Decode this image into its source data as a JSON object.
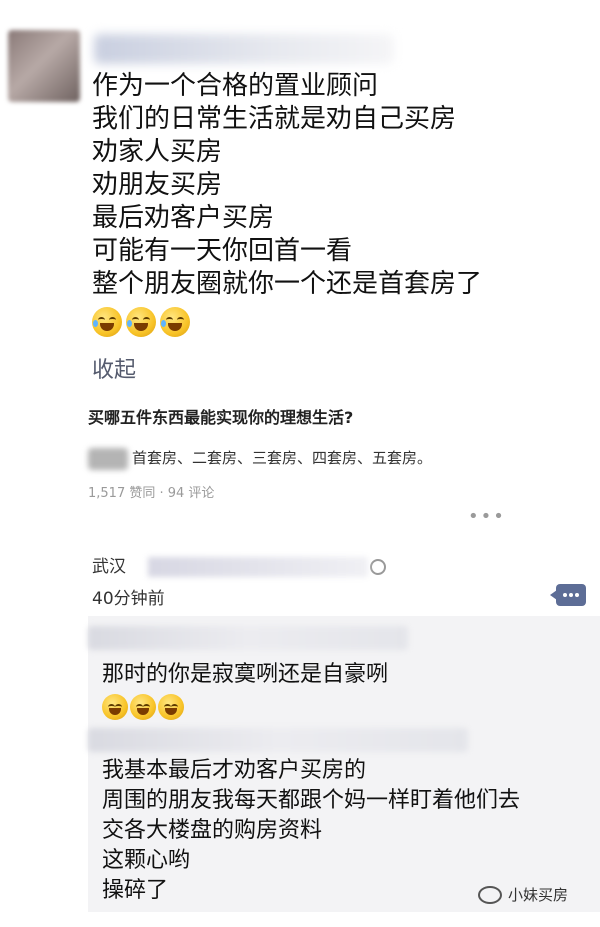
{
  "post": {
    "lines": [
      "作为一个合格的置业顾问",
      "我们的日常生活就是劝自己买房",
      "劝家人买房",
      "劝朋友买房",
      "最后劝客户买房",
      "可能有一天你回首一看",
      "整个朋友圈就你一个还是首套房了"
    ],
    "emoji": "laughing-tears-emoji",
    "collapse_label": "收起"
  },
  "shared_card": {
    "title": "买哪五件东西最能实现你的理想生活?",
    "body": "首套房、二套房、三套房、四套房、五套房。",
    "stats": "1,517 赞同 · 94 评论"
  },
  "meta": {
    "location": "武汉",
    "time": "40分钟前"
  },
  "comments": [
    {
      "text": "那时的你是寂寞咧还是自豪咧",
      "emoji": "grin-emoji"
    },
    {
      "lines": [
        "我基本最后才劝客户买房的",
        "周围的朋友我每天都跟个妈一样盯着他们去",
        "交各大楼盘的购房资料",
        "这颗心哟",
        "操碎了"
      ]
    }
  ],
  "watermark": {
    "text": "小妹买房",
    "icon": "wechat-logo-icon"
  },
  "colors": {
    "link": "#555b6e",
    "comment_bg": "#f3f3f5",
    "comment_icon": "#5d6d96"
  }
}
